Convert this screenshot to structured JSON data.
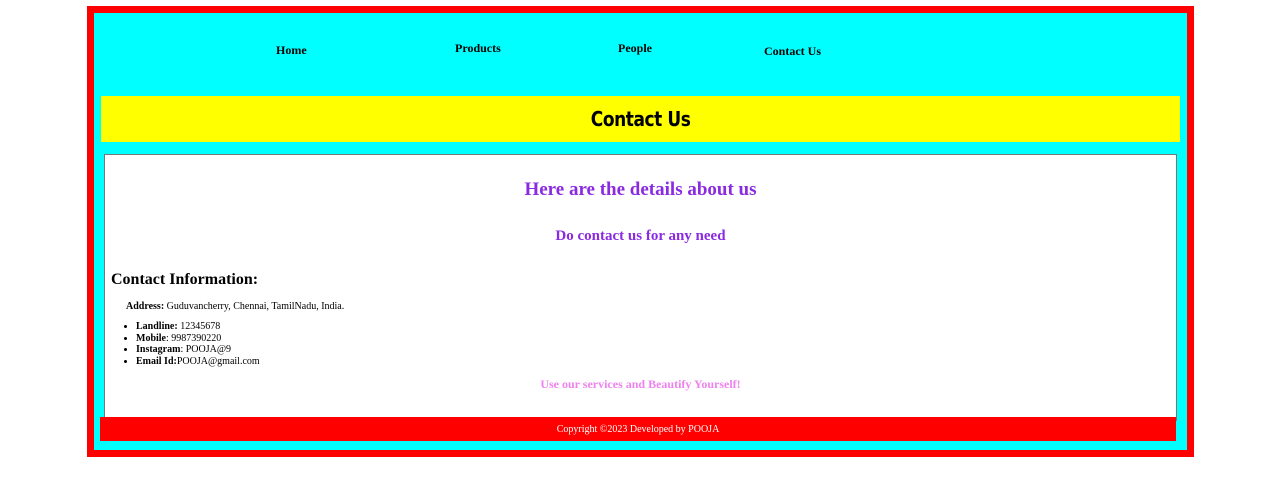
{
  "nav": {
    "items": [
      "Home",
      "Products",
      "People",
      "Contact Us"
    ]
  },
  "banner": {
    "title": "Contact Us"
  },
  "main": {
    "heading": "Here are the details about us",
    "subheading": "Do contact us for any need",
    "contact_title": "Contact Information:",
    "address_label": "Address:",
    "address_value": "Guduvancherry, Chennai, TamilNadu, India.",
    "contacts": [
      {
        "label": "Landline:",
        "value": " 12345678"
      },
      {
        "label": "Mobile",
        "value": ": 9987390220"
      },
      {
        "label": "Instagram",
        "value": ": POOJA@9"
      },
      {
        "label": "Email Id:",
        "value": "POOJA@gmail.com"
      }
    ],
    "tagline": "Use our services and Beautify Yourself!"
  },
  "footer": {
    "text": "Copyright ©2023 Developed by POOJA"
  },
  "colors": {
    "frame": "#ff0000",
    "background": "#00ffff",
    "banner": "#ffff00",
    "heading": "#8a2be2",
    "tagline": "#ee82ee"
  }
}
